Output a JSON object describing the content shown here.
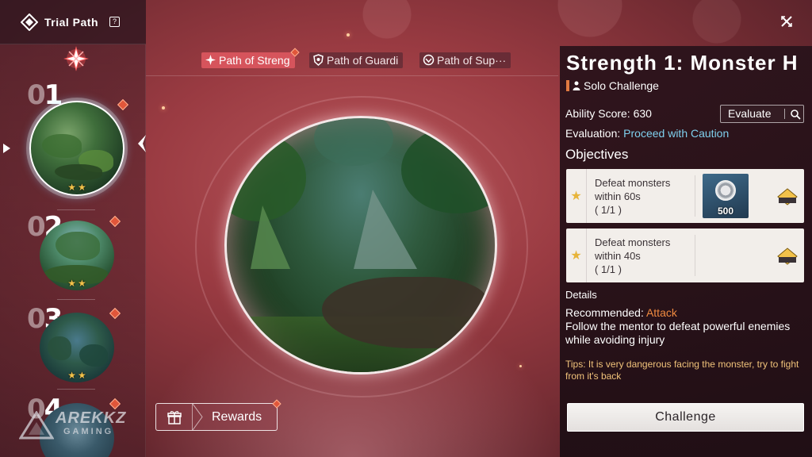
{
  "header": {
    "title": "Trial Path",
    "help_icon": "?"
  },
  "stages": [
    {
      "zero": "0",
      "digit": "1",
      "stars": "★★"
    },
    {
      "zero": "0",
      "digit": "2",
      "stars": "★★"
    },
    {
      "zero": "0",
      "digit": "3",
      "stars": "★★"
    },
    {
      "zero": "0",
      "digit": "4",
      "stars": ""
    }
  ],
  "tabs": [
    {
      "label": "Path of Streng",
      "icon": "strength-emblem-icon",
      "active": true
    },
    {
      "label": "Path of Guardi",
      "icon": "shield-emblem-icon",
      "active": false
    },
    {
      "label": "Path of Sup···",
      "icon": "support-emblem-icon",
      "active": false
    }
  ],
  "rewards": {
    "label": "Rewards",
    "icon": "gift-icon"
  },
  "watermark": {
    "line1": "AREKKZ",
    "line2": "GAMING"
  },
  "panel": {
    "title": "Strength 1: Monster H",
    "mode": "Solo Challenge",
    "ability_score": "Ability Score: 630",
    "evaluate_label": "Evaluate",
    "evaluation_label": "Evaluation: ",
    "evaluation_value": "Proceed with Caution",
    "objectives_heading": "Objectives",
    "objectives": [
      {
        "line1": "Defeat monsters",
        "line2": "within 60s",
        "progress": "( 1/1 )",
        "reward_qty": "500"
      },
      {
        "line1": "Defeat monsters",
        "line2": "within 40s",
        "progress": "( 1/1 )",
        "reward_qty": ""
      }
    ],
    "details_heading": "Details",
    "recommended_label": "Recommended: ",
    "recommended_value": "Attack",
    "description": "Follow the mentor to defeat powerful enemies while avoiding injury",
    "tips": "Tips: It is very dangerous facing the monster, try to fight from it's back",
    "challenge_label": "Challenge"
  },
  "colors": {
    "accent_tab": "#d6545c",
    "evaluation": "#7fd0ee",
    "recommended": "#f08a40",
    "tips": "#f0c27a",
    "star": "#f2c24a"
  }
}
